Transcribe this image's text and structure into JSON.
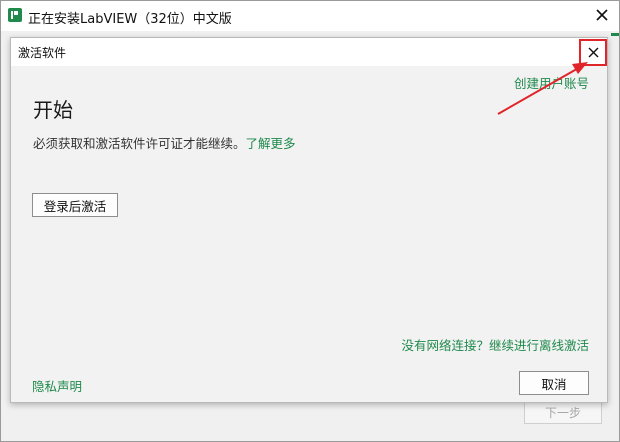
{
  "installer": {
    "title": "正在安装LabVIEW（32位）中文版",
    "next_label": "下一步",
    "accent_color": "#1f8a4c"
  },
  "dialog": {
    "title": "激活软件",
    "create_account": "创建用户账号",
    "heading": "开始",
    "description": "必须获取和激活软件许可证才能继续。",
    "learn_more": "了解更多",
    "login_button": "登录后激活",
    "offline_link": "没有网络连接？继续进行离线激活",
    "privacy_link": "隐私声明",
    "cancel_button": "取消"
  },
  "annotation": {
    "color": "#e0242a",
    "icons": [
      "close-icon",
      "arrow-annotation"
    ]
  }
}
